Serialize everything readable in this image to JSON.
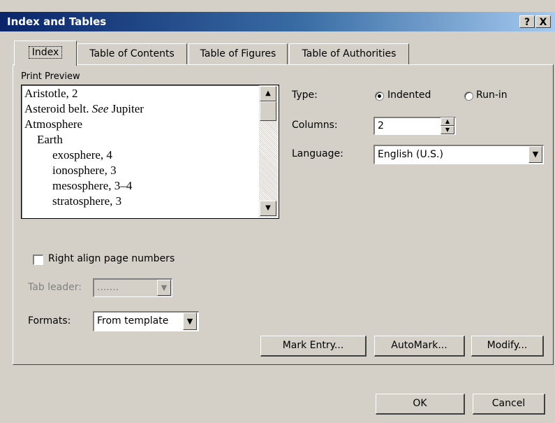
{
  "window": {
    "title": "Index and Tables",
    "help_label": "?",
    "close_label": "X"
  },
  "tabs": [
    {
      "label": "Index",
      "active": true
    },
    {
      "label": "Table of Contents",
      "active": false
    },
    {
      "label": "Table of Figures",
      "active": false
    },
    {
      "label": "Table of Authorities",
      "active": false
    }
  ],
  "preview": {
    "label": "Print Preview",
    "lines": [
      "Aristotle, 2",
      "Asteroid belt. See Jupiter",
      "Atmosphere",
      "Earth",
      "exosphere, 4",
      "ionosphere, 3",
      "mesosphere, 3–4",
      "stratosphere, 3"
    ]
  },
  "type": {
    "label": "Type:",
    "options": [
      "Indented",
      "Run-in"
    ],
    "selected": "Indented"
  },
  "columns": {
    "label": "Columns:",
    "value": "2"
  },
  "language": {
    "label": "Language:",
    "value": "English (U.S.)"
  },
  "right_align": {
    "label": "Right align page numbers",
    "checked": false
  },
  "tab_leader": {
    "label": "Tab leader:",
    "value": ".......",
    "enabled": false
  },
  "formats": {
    "label": "Formats:",
    "value": "From template"
  },
  "buttons": {
    "mark_entry": "Mark Entry...",
    "automark": "AutoMark...",
    "modify": "Modify...",
    "ok": "OK",
    "cancel": "Cancel"
  },
  "icons": {
    "scroll_up": "up-arrow-icon",
    "scroll_down": "down-arrow-icon",
    "dropdown": "chevron-down-icon"
  }
}
